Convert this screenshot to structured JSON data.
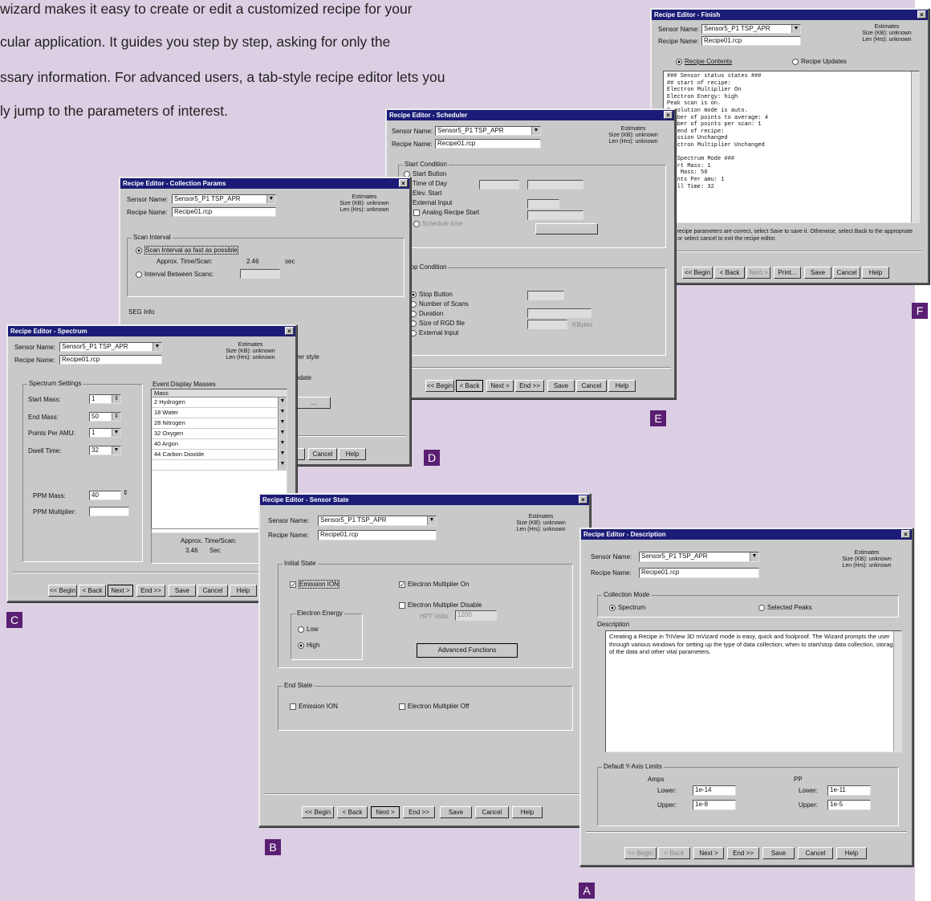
{
  "intro": {
    "lines": [
      "wizard makes it easy to create or edit a customized recipe for your",
      "cular application. It guides you step by step, asking for only the",
      "ssary information. For advanced users, a tab-style recipe editor lets you",
      "ly jump to the parameters of interest."
    ]
  },
  "common": {
    "sensor_label": "Sensor Name:",
    "sensor_value": "Sensor5_P1 TSP_APR",
    "recipe_label": "Recipe Name:",
    "recipe_value": "Recipe01.rcp",
    "est_title": "Estimates",
    "est_size": "Size (KB): unknown",
    "est_len": "Len (Hrs): unknown",
    "btn_begin": "<< Begin",
    "btn_back": "< Back",
    "btn_next": "Next >",
    "btn_end": "End >>",
    "btn_save": "Save",
    "btn_cancel": "Cancel",
    "btn_help": "Help"
  },
  "labels": {
    "A": "A",
    "B": "B",
    "C": "C",
    "D": "D",
    "E": "E",
    "F": "F"
  },
  "win_f": {
    "title": "Recipe Editor - Finish",
    "radio_contents": "Recipe Contents",
    "radio_updates": "Recipe Updates",
    "contents": [
      "### Sensor status states ###",
      "## start of recipe:",
      "   Electron Multiplier On",
      "   Electron Energy: high",
      "   Peak scan is on.",
      "   Resolution mode is auto.",
      "   Number of points to average: 4",
      "   Number of points per scan: 1",
      "## end of recipe:",
      "   Emission Unchanged",
      "   Electron Multiplier Unchanged",
      "",
      "## Spectrum Mode ###",
      "Start Mass: 1",
      "End Mass: 50",
      "Points Per amu: 1",
      "Dwell Time: 32"
    ],
    "note": "If the recipe parameters are correct, select Save to save it. Otherwise, select Back to the appropriate fields or select cancel to exit the recipe editor.",
    "btn_print": "Print..."
  },
  "win_e": {
    "title": "Recipe Editor - Scheduler",
    "start_group": "Start Condition",
    "start_options": [
      "Start Button",
      "Time of Day",
      "Elev. Start",
      "External Input"
    ],
    "start_sub": [
      "Analog Recipe Start",
      "Schedule time"
    ],
    "stop_group": "Stop Condition",
    "stop_options": [
      "Stop Button",
      "Number of Scans",
      "Duration",
      "Size of RGD file",
      "External Input"
    ],
    "stop_unit": "KBytes"
  },
  "win_d": {
    "title": "Recipe Editor - Collection Params",
    "scan_group": "Scan Interval",
    "fast_option": "Scan Interval as fast as possible",
    "approx_label": "Approx. Time/Scan:",
    "approx_value": "2.46",
    "approx_unit": "sec",
    "interval_option": "Interval Between Scans:",
    "sec_group": "SEG Info",
    "trunc1": "ver style",
    "trunc2": "pdate",
    "trunc_btn": "..."
  },
  "win_c": {
    "title": "Recipe Editor - Spectrum",
    "settings_group": "Spectrum Settings",
    "start_mass_label": "Start Mass:",
    "start_mass": "1",
    "end_mass_label": "End Mass:",
    "end_mass": "50",
    "ppa_label": "Points Per AMU:",
    "ppa": "1",
    "dwell_label": "Dwell Time:",
    "dwell": "32",
    "ppm_mass_label": "PPM Mass:",
    "ppm_mass": "40",
    "ppm_mult_label": "PPM Multiplier:",
    "ppm_mult": "",
    "list_header": "Event Display Masses",
    "list_col": "Mass",
    "masses": [
      "2 Hydrogen",
      "18 Water",
      "28 Nitrogen",
      "32 Oxygen",
      "40 Argon",
      "44 Carbon Dioxide"
    ],
    "approx_label": "Approx. Time/Scan:",
    "approx_value": "3.46",
    "approx_unit": "Sec"
  },
  "win_b": {
    "title": "Recipe Editor - Sensor State",
    "initial_group": "Initial State",
    "emission": "Emission ION",
    "em_on": "Electron Multiplier On",
    "em_disable": "Electron Multiplier Disable",
    "em_volts": "HPT Volts",
    "em_volts_value": "1200",
    "energy_group": "Electron Energy",
    "energy_low": "Low",
    "energy_high": "High",
    "advanced_btn": "Advanced Functions",
    "end_group": "End State",
    "end_emission": "Emission ION",
    "end_em": "Electron Multiplier Off"
  },
  "win_a": {
    "title": "Recipe Editor - Description",
    "mode_group": "Collection Mode",
    "mode_spectrum": "Spectrum",
    "mode_peaks": "Selected Peaks",
    "desc_group": "Description",
    "desc_text": "Creating a Recipe in TriView 3D mVizard mode is easy, quick and foolproof. The Wizard prompts the user through various windows for setting up the type of data collection, when to start/stop data collection, storage of the data and other vital parameters.",
    "ylimits_group": "Default Y-Axis Limits",
    "amps_group": "Amps",
    "pp_group": "PP",
    "lower_label": "Lower:",
    "upper_label": "Upper:",
    "amps_lower": "1e-14",
    "amps_upper": "1e-8",
    "pp_lower": "1e-11",
    "pp_upper": "1e-5"
  }
}
